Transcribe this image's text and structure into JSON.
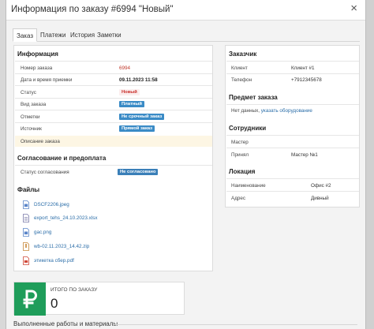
{
  "modal": {
    "title": "Информация по заказу #6994 \"Новый\"",
    "close_symbol": "×"
  },
  "tabs": [
    "Заказ",
    "Платежи",
    "История",
    "Заметки"
  ],
  "info": {
    "title": "Информация",
    "rows": {
      "order_number": {
        "label": "Номер заказа",
        "value": "6994"
      },
      "datetime": {
        "label": "Дата и время приемки",
        "value": "09.11.2023 11:58"
      },
      "status": {
        "label": "Статус",
        "value": "Новый"
      },
      "order_type": {
        "label": "Вид заказа",
        "value": "Платный"
      },
      "marks": {
        "label": "Отметки",
        "value": "Не срочный заказ"
      },
      "source": {
        "label": "Источник",
        "value": "Прямой заказ"
      },
      "description": {
        "label": "Описание заказа"
      }
    }
  },
  "approval": {
    "title": "Согласование и предоплата",
    "label": "Статус согласования",
    "value": "Не согласовано"
  },
  "files": {
    "title": "Файлы",
    "items": [
      {
        "name": "DSCF2206.jpeg",
        "icon": "image-file-icon"
      },
      {
        "name": "export_tehs_24.10.2023.xlsx",
        "icon": "document-file-icon"
      },
      {
        "name": "gac.png",
        "icon": "image-file-icon"
      },
      {
        "name": "wb-02.11.2023_14.42.zip",
        "icon": "archive-file-icon"
      },
      {
        "name": "этикетка сбер.pdf",
        "icon": "pdf-file-icon"
      }
    ]
  },
  "customer": {
    "title": "Заказчик",
    "client_label": "Клиент",
    "client_value": "Клиент #1",
    "phone_label": "Телефон",
    "phone_value": "+7912345678"
  },
  "subject": {
    "title": "Предмет заказа",
    "text": "Нет данных,",
    "link": "указать оборудование"
  },
  "staff": {
    "title": "Сотрудники",
    "master_label": "Мастер",
    "master_value": "",
    "accepted_label": "Принял",
    "accepted_value": "Мастер №1"
  },
  "location": {
    "title": "Локация",
    "name_label": "Наименование",
    "name_value": "Офис #2",
    "address_label": "Адрес",
    "address_value": "Дивный"
  },
  "total": {
    "currency_symbol": "₽",
    "label": "ИТОГО ПО ЗАКАЗУ",
    "value": "0"
  },
  "works": {
    "title": "Выполненные работы и материалы"
  },
  "colors": {
    "accent": "#3a8bc6",
    "total_green": "#1f9d5a",
    "order_number_red": "#c0392b"
  }
}
